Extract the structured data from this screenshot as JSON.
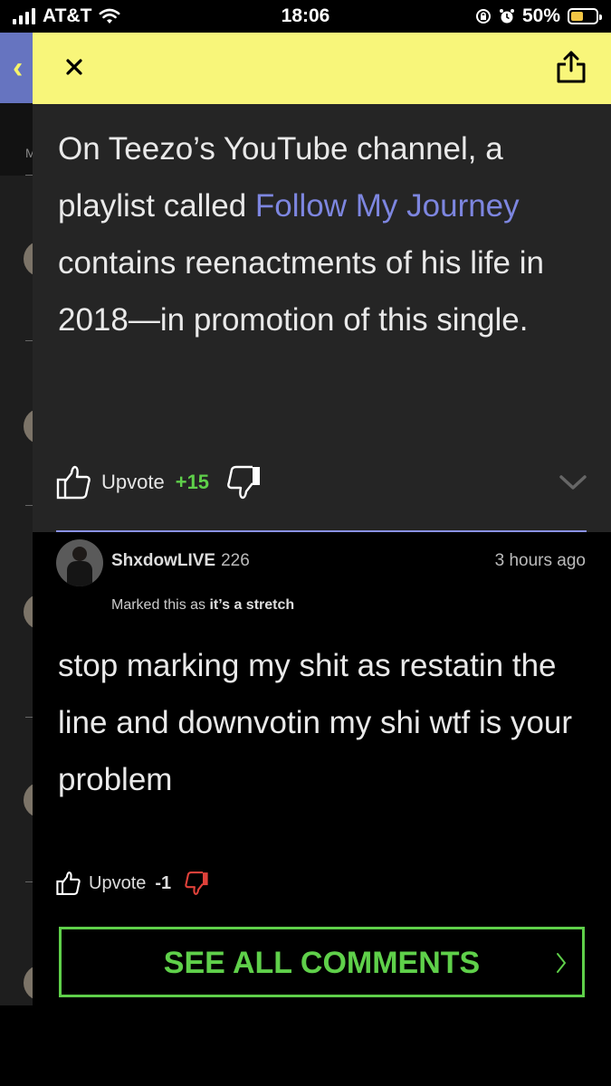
{
  "status_bar": {
    "carrier": "AT&T",
    "time": "18:06",
    "battery": "50%",
    "battery_level": 0.5
  },
  "annotation": {
    "text_before": "On Teezo’s YouTube channel, a playlist called ",
    "link_text": "Follow My Journey",
    "text_after": " contains reenactments of his life in 2018—in promotion of this single.",
    "upvote_label": "Upvote",
    "vote_count": "+15"
  },
  "comment": {
    "username": "ShxdowLIVE",
    "iq": "226",
    "time_ago": "3 hours ago",
    "marked_prefix": "Marked this as ",
    "marked_label": "it’s a stretch",
    "body": "stop marking my shit as restatin the line and downvotin my shi wtf is your problem",
    "upvote_label": "Upvote",
    "vote_count": "-1"
  },
  "see_all_label": "SEE ALL COMMENTS",
  "colors": {
    "header_yellow": "#f8f67a",
    "link_blue": "#7d86e0",
    "accent_green": "#5fd04a",
    "downvote_red": "#e0413a"
  },
  "icons": [
    "close-icon",
    "share-icon",
    "thumbs-up-icon",
    "thumbs-down-icon",
    "chevron-down-icon",
    "chevron-right-icon",
    "wifi-icon",
    "alarm-icon",
    "battery-icon"
  ]
}
